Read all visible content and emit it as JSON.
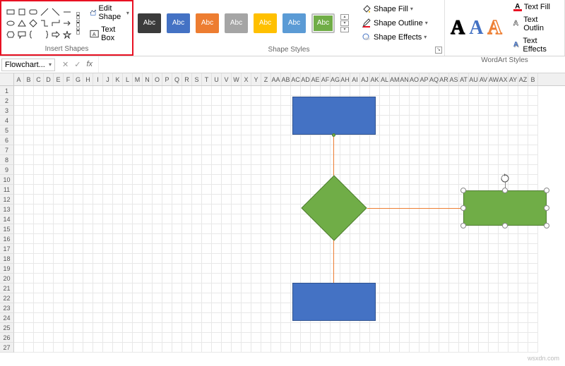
{
  "ribbon": {
    "insert_shapes": {
      "label": "Insert Shapes",
      "edit_shape": "Edit Shape",
      "text_box": "Text Box"
    },
    "shape_styles": {
      "label": "Shape Styles",
      "swatch_text": "Abc",
      "colors": [
        "#3b3b3b",
        "#4472c4",
        "#ed7d31",
        "#a5a5a5",
        "#ffc000",
        "#5b9bd5",
        "#70ad47"
      ],
      "selected_index": 6,
      "fill": "Shape Fill",
      "outline": "Shape Outline",
      "effects": "Shape Effects"
    },
    "wordart": {
      "label": "WordArt Styles",
      "letter": "A",
      "text_fill": "Text Fill",
      "text_outline": "Text Outlin",
      "text_effects": "Text Effects"
    }
  },
  "formula_bar": {
    "name_box": "Flowchart...",
    "cancel": "✕",
    "confirm": "✓",
    "fx": "fx"
  },
  "grid": {
    "columns": [
      "A",
      "B",
      "C",
      "D",
      "E",
      "F",
      "G",
      "H",
      "I",
      "J",
      "K",
      "L",
      "M",
      "N",
      "O",
      "P",
      "Q",
      "R",
      "S",
      "T",
      "U",
      "V",
      "W",
      "X",
      "Y",
      "Z",
      "AA",
      "AB",
      "AC",
      "AD",
      "AE",
      "AF",
      "AG",
      "AH",
      "AI",
      "AJ",
      "AK",
      "AL",
      "AM",
      "AN",
      "AO",
      "AP",
      "AQ",
      "AR",
      "AS",
      "AT",
      "AU",
      "AV",
      "AW",
      "AX",
      "AY",
      "AZ",
      "B"
    ],
    "rows": 27
  },
  "shapes": {
    "top_rect": {
      "type": "process",
      "color": "blue"
    },
    "diamond": {
      "type": "decision",
      "color": "green"
    },
    "right_rect": {
      "type": "process",
      "color": "green",
      "selected": true
    },
    "bottom_rect": {
      "type": "process",
      "color": "blue"
    }
  },
  "watermark": "wsxdn.com"
}
